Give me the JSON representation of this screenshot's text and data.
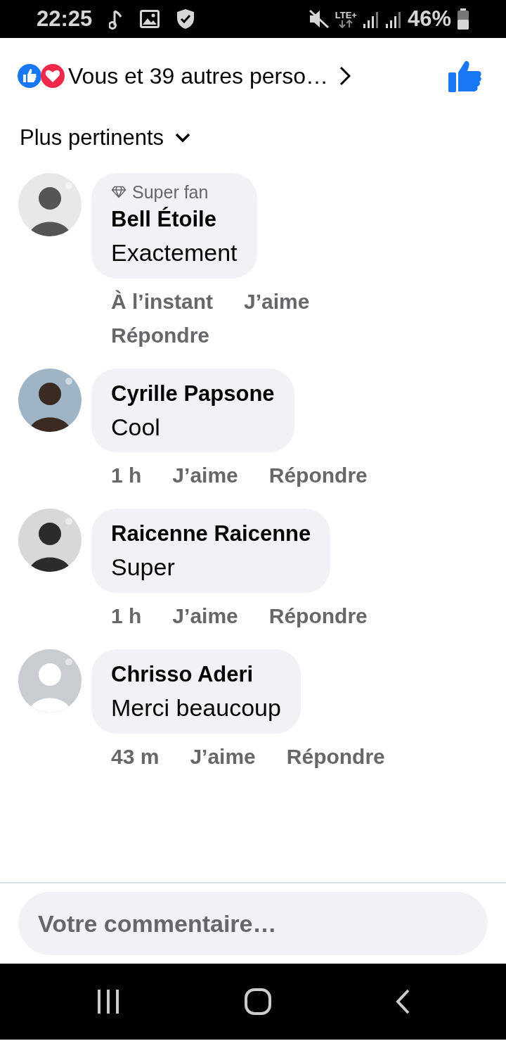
{
  "status_bar": {
    "time": "22:25",
    "network": "LTE+",
    "battery": "46%"
  },
  "reactions": {
    "summary": "Vous et 39 autres perso…",
    "liked": true
  },
  "sort": {
    "label": "Plus pertinents"
  },
  "comments": [
    {
      "badge": "Super fan",
      "name": "Bell Étoile",
      "text": "Exactement",
      "time": "À l’instant",
      "like": "J’aime",
      "reply": "Répondre"
    },
    {
      "name": "Cyrille Papsone",
      "text": "Cool",
      "time": "1 h",
      "like": "J’aime",
      "reply": "Répondre"
    },
    {
      "name": "Raicenne Raicenne",
      "text": "Super",
      "time": "1 h",
      "like": "J’aime",
      "reply": "Répondre"
    },
    {
      "name": "Chrisso Aderi",
      "text": "Merci beaucoup",
      "time": "43 m",
      "like": "J’aime",
      "reply": "Répondre"
    }
  ],
  "composer": {
    "placeholder": "Votre commentaire…"
  }
}
